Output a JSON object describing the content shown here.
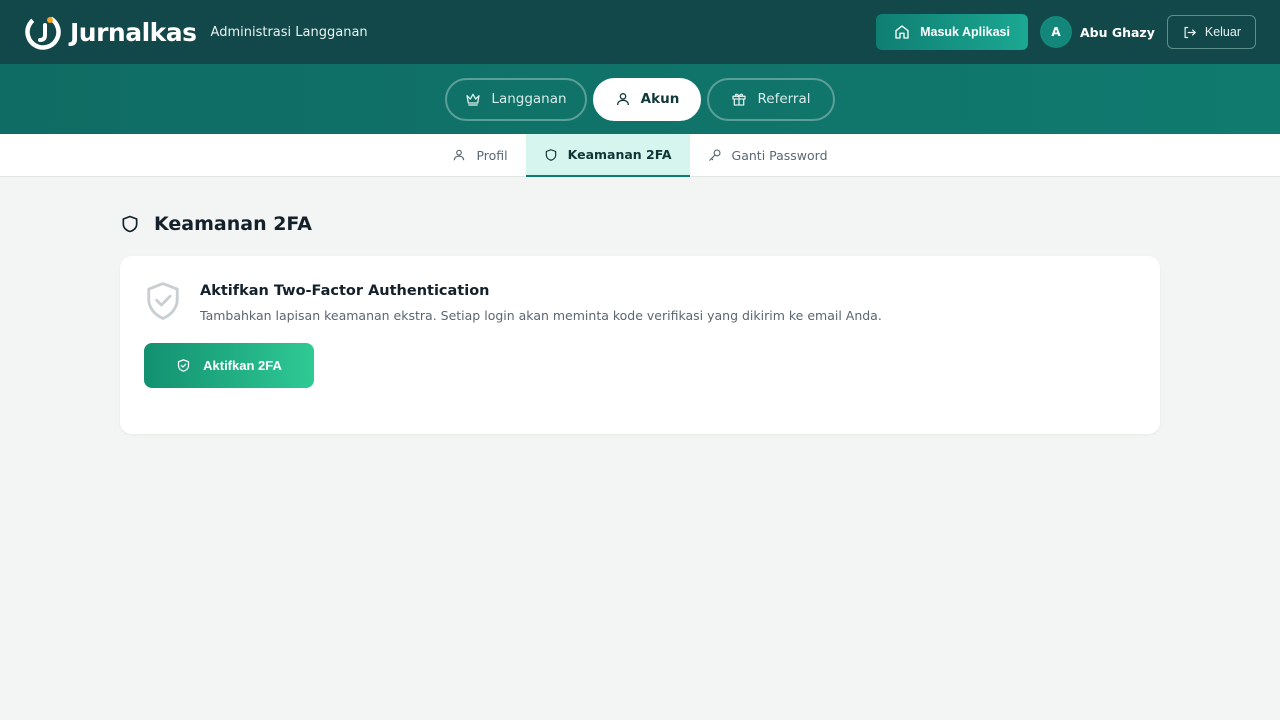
{
  "header": {
    "logo_text": "Jurnalkas",
    "subtitle": "Administrasi Langganan",
    "masuk_label": "Masuk Aplikasi",
    "avatar_initial": "A",
    "username": "Abu Ghazy",
    "keluar_label": "Keluar"
  },
  "main_tabs": [
    {
      "label": "Langganan",
      "icon": "crown-icon",
      "active": false
    },
    {
      "label": "Akun",
      "icon": "user-icon",
      "active": true
    },
    {
      "label": "Referral",
      "icon": "gift-icon",
      "active": false
    }
  ],
  "sub_tabs": [
    {
      "label": "Profil",
      "icon": "user-icon",
      "active": false
    },
    {
      "label": "Keamanan 2FA",
      "icon": "shield-icon",
      "active": true
    },
    {
      "label": "Ganti Password",
      "icon": "key-icon",
      "active": false
    }
  ],
  "section": {
    "title": "Keamanan 2FA"
  },
  "card": {
    "title": "Aktifkan Two-Factor Authentication",
    "description": "Tambahkan lapisan keamanan ekstra. Setiap login akan meminta kode verifikasi yang dikirim ke email Anda.",
    "button_label": "Aktifkan 2FA"
  },
  "colors": {
    "header_bg": "#12484a",
    "tabbar_bg": "#0f6c64",
    "accent": "#1ba893",
    "logo_accent": "#f5a623"
  }
}
